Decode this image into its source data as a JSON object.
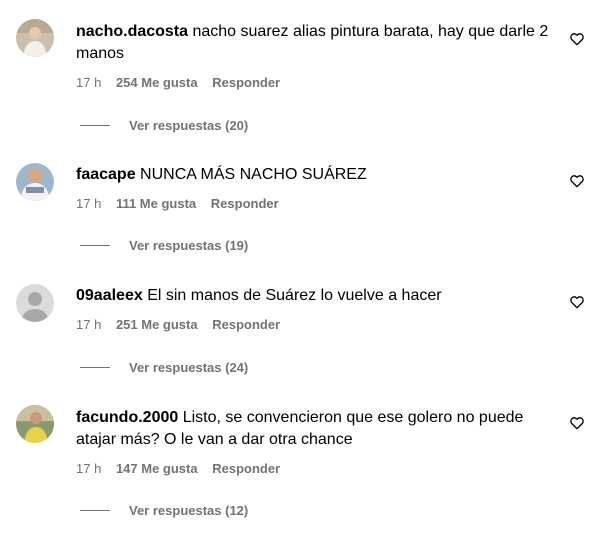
{
  "comments": [
    {
      "username": "nacho.dacosta",
      "text": "nacho suarez alias pintura barata, hay que darle 2 manos",
      "time": "17 h",
      "likes": "254 Me gusta",
      "reply_label": "Responder",
      "view_replies": "Ver respuestas (20)",
      "like_icon": "heart-outline-icon"
    },
    {
      "username": "faacape",
      "text": "NUNCA MÁS NACHO SUÁREZ",
      "time": "17 h",
      "likes": "111 Me gusta",
      "reply_label": "Responder",
      "view_replies": "Ver respuestas (19)",
      "like_icon": "heart-outline-icon"
    },
    {
      "username": "09aaleex",
      "text": "El sin manos de Suárez lo vuelve a hacer",
      "time": "17 h",
      "likes": "251 Me gusta",
      "reply_label": "Responder",
      "view_replies": "Ver respuestas (24)",
      "like_icon": "heart-outline-icon"
    },
    {
      "username": "facundo.2000",
      "text": "Listo, se convencieron que ese golero no puede atajar más? O le van a dar otra chance",
      "time": "17 h",
      "likes": "147 Me gusta",
      "reply_label": "Responder",
      "view_replies": "Ver respuestas (12)",
      "like_icon": "heart-outline-icon"
    }
  ],
  "colors": {
    "text": "#000000",
    "secondary": "#737373",
    "background": "#ffffff"
  }
}
